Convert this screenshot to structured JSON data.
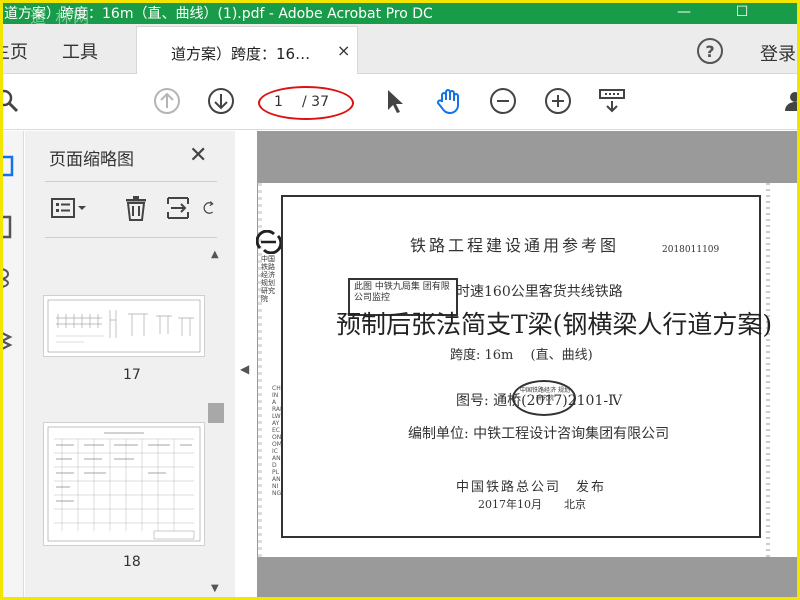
{
  "window": {
    "title": "道方案）跨度：16m（直、曲线）(1).pdf - Adobe Acrobat Pro DC",
    "watermark": "道 林网",
    "minimize": "—",
    "maximize": "☐"
  },
  "tabs": {
    "home": "主页",
    "tools": "工具",
    "document": "道方案）跨度：16…",
    "close": "×",
    "help": "?",
    "login": "登录"
  },
  "toolbar": {
    "page_current": "1",
    "page_total": "/ 37"
  },
  "thumbnails_panel": {
    "title": "页面缩略图",
    "close": "✕",
    "pages": [
      {
        "label": "17"
      },
      {
        "label": "18"
      }
    ]
  },
  "document": {
    "header": "铁路工程建设通用参考图",
    "date_stamp": "2018011109",
    "subtitle": "时速160公里客货共线铁路",
    "main_title": "预制后张法简支T梁(钢横梁人行道方案)",
    "span": "跨度: 16m　 (直、曲线)",
    "drawing_no": "图号: 通桥(2017)2101-Ⅳ",
    "compiler": "编制单位: 中铁工程设计咨询集团有限公司",
    "publisher": "中国铁路总公司　发布",
    "pub_date": "2017年10月　　北京",
    "side_org": "中国铁路经济规划研究院",
    "side_org_en": "CHINA RAILWAY ECONOMIC AND PLANNING",
    "stamp_text": "此图 中铁九局集 团有限公司监控 ",
    "oval_stamp_text": "中国铁路经济 规划研究院"
  }
}
